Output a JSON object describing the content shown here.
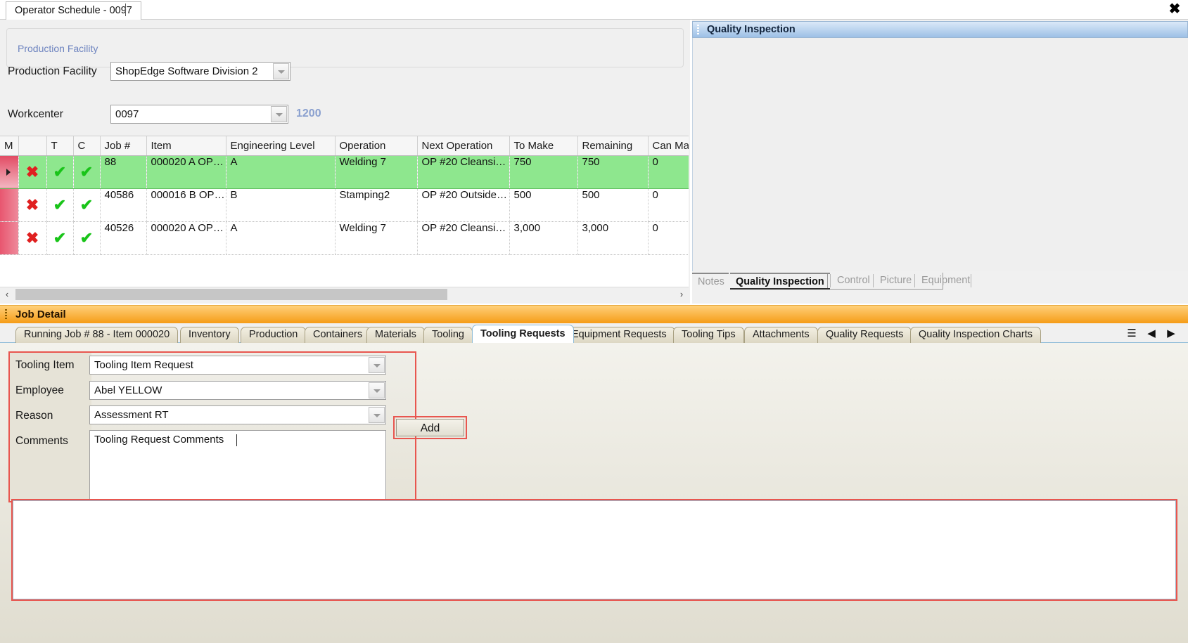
{
  "window": {
    "document_tab": "Operator Schedule - 0097",
    "close_icon": "close-icon"
  },
  "facility": {
    "group_legend": "Production Facility",
    "label": "Production Facility",
    "value": "ShopEdge Software Division 2"
  },
  "workcenter": {
    "label": "Workcenter",
    "value": "0097",
    "number": "1200"
  },
  "grid": {
    "columns": [
      "M",
      "",
      "T",
      "C",
      "Job #",
      "Item",
      "Engineering Level",
      "Operation",
      "Next Operation",
      "To Make",
      "Remaining",
      "Can Ma"
    ],
    "rows": [
      {
        "selected": true,
        "m": "✖",
        "t": "✔",
        "c": "✔",
        "job": "88",
        "item": "000020  A  OP…",
        "eng_level": "A",
        "operation": "Welding 7",
        "next_operation": "OP  #20  Cleansi…",
        "to_make": "750",
        "remaining": "750",
        "can_make": "0"
      },
      {
        "selected": false,
        "m": "✖",
        "t": "✔",
        "c": "✔",
        "job": "40586",
        "item": "000016  B  OP…",
        "eng_level": "B",
        "operation": "Stamping2",
        "next_operation": "OP  #20  Outside…",
        "to_make": "500",
        "remaining": "500",
        "can_make": "0"
      },
      {
        "selected": false,
        "m": "✖",
        "t": "✔",
        "c": "✔",
        "job": "40526",
        "item": "000020  A  OP…",
        "eng_level": "A",
        "operation": "Welding 7",
        "next_operation": "OP  #20  Cleansi…",
        "to_make": "3,000",
        "remaining": "3,000",
        "can_make": "0"
      }
    ],
    "scroll_left_icon": "‹",
    "scroll_right_icon": "›"
  },
  "quality_panel": {
    "title": "Quality Inspection",
    "tabs": [
      {
        "label": "Notes",
        "selected": false
      },
      {
        "label": "Quality Inspection",
        "selected": true
      },
      {
        "label": "Control",
        "selected": false
      },
      {
        "label": "Picture",
        "selected": false
      },
      {
        "label": "Equipment",
        "selected": false
      }
    ]
  },
  "job_detail": {
    "title": "Job Detail",
    "tabs": [
      {
        "label": "Running Job # 88 - Item 000020",
        "selected": false
      },
      {
        "label": "Inventory",
        "selected": false
      },
      {
        "label": "Production",
        "selected": false
      },
      {
        "label": "Containers",
        "selected": false
      },
      {
        "label": "Materials",
        "selected": false
      },
      {
        "label": "Tooling",
        "selected": false
      },
      {
        "label": "Tooling Requests",
        "selected": true
      },
      {
        "label": "Equipment Requests",
        "selected": false
      },
      {
        "label": "Tooling Tips",
        "selected": false
      },
      {
        "label": "Attachments",
        "selected": false
      },
      {
        "label": "Quality Requests",
        "selected": false
      },
      {
        "label": "Quality Inspection Charts",
        "selected": false
      }
    ],
    "nav": {
      "menu_icon": "☰",
      "prev_icon": "◀",
      "next_icon": "▶"
    }
  },
  "tooling_request_form": {
    "tooling_item_label": "Tooling Item",
    "tooling_item_value": "Tooling Item Request",
    "employee_label": "Employee",
    "employee_value": "Abel YELLOW",
    "reason_label": "Reason",
    "reason_value": "Assessment RT",
    "comments_label": "Comments",
    "comments_value": "Tooling Request Comments",
    "add_label": "Add"
  },
  "colors": {
    "highlight_row": "#8ee78e",
    "accent_red_outline": "#e8564f",
    "caption_orange": "#f59c17",
    "caption_blue": "#9dc0e6",
    "link_blue": "#8aa0cf"
  }
}
